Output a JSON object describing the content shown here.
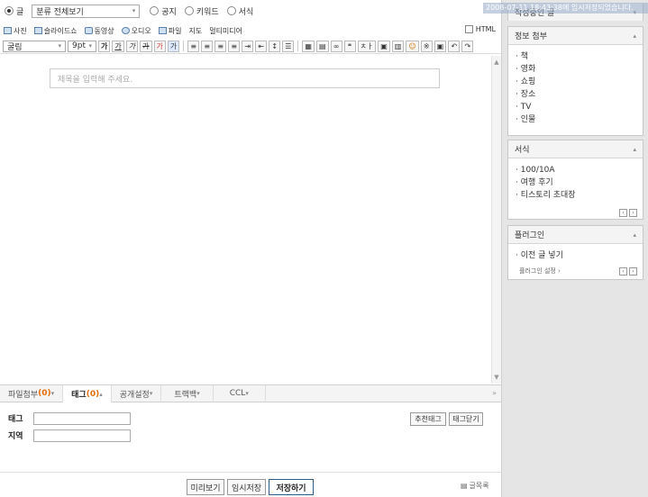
{
  "topbar": {
    "radio_post": "글",
    "category_select": "분류 전체보기",
    "radio_notice": "공지",
    "radio_keyword": "키워드",
    "radio_form": "서식"
  },
  "toolbar1": {
    "photo": "사진",
    "slideshow": "슬라이드쇼",
    "video": "동영상",
    "audio": "오디오",
    "file": "파일",
    "map": "지도",
    "multimedia": "멀티미디어",
    "html_label": "HTML"
  },
  "toolbar2": {
    "font_select": "굴림",
    "size_select": "9pt",
    "bold": "가",
    "underline": "가",
    "italic": "가",
    "strike": "가",
    "fontcolor": "가",
    "bgcolor": "가",
    "quote": "❝",
    "hanja": "ㅊㅏ",
    "undo": "↶",
    "redo": "↷"
  },
  "editor": {
    "title_placeholder": "제목을 입력해 주세요."
  },
  "tabs": [
    {
      "label": "파일첨부",
      "count": "(0)",
      "suffix": "▾"
    },
    {
      "label": "태그",
      "count": "(0)",
      "suffix": "▴"
    },
    {
      "label": "공개설정",
      "suffix": "▾"
    },
    {
      "label": "트랙백",
      "suffix": "▾"
    },
    {
      "label": "CCL",
      "suffix": "▾"
    }
  ],
  "tagform": {
    "tag_label": "태그",
    "region_label": "지역",
    "recommend_button": "추천태그",
    "close_button": "태그닫기"
  },
  "bottom": {
    "preview": "미리보기",
    "temp_save": "임시저장",
    "save": "저장하기",
    "post_list": "글목록"
  },
  "sidebar": {
    "autosave_notice": "2008-07-11 18:43:38에 임시저장되었습니다.",
    "drafts_title": "작성중인 글",
    "info_attach": {
      "title": "정보 첨부",
      "items": [
        "책",
        "영화",
        "쇼핑",
        "장소",
        "TV",
        "인물"
      ]
    },
    "templates": {
      "title": "서식",
      "items": [
        "100/10A",
        "여행 후기",
        "티스토리 초대장"
      ]
    },
    "plugins": {
      "title": "플러그인",
      "items": [
        "이전 글 넣기"
      ],
      "settings": "플러그인 설정 ›"
    }
  },
  "colors": {
    "accent_count": "#e36c09",
    "save_border": "#2f5b8a",
    "sidebar_bg": "#e5e5e5"
  }
}
